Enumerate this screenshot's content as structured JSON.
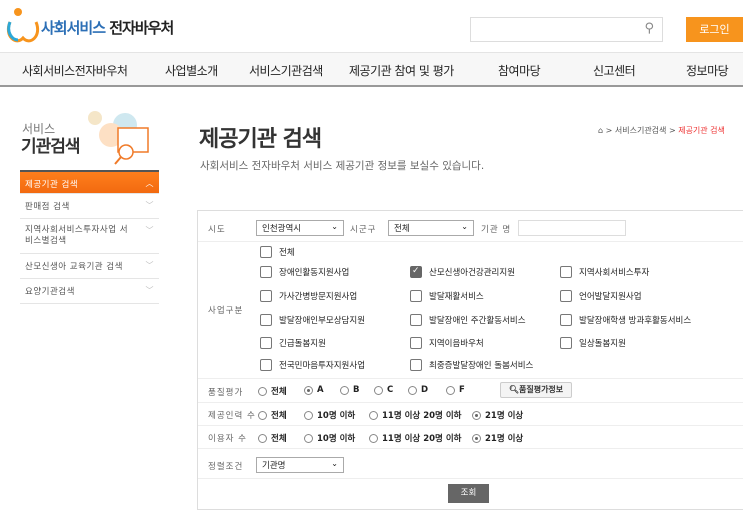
{
  "header": {
    "logo_part1": "사회서비스",
    "logo_part2": "전자바우처",
    "search_placeholder": "",
    "login": "로그인"
  },
  "nav": [
    "사회서비스전자바우처",
    "사업별소개",
    "서비스기관검색",
    "제공기관 참여 및 평가",
    "참여마당",
    "신고센터",
    "정보마당"
  ],
  "sidebar": {
    "title_small": "서비스",
    "title_large": "기관검색",
    "items": [
      {
        "label": "제공기관 검색",
        "active": true
      },
      {
        "label": "판매점 검색"
      },
      {
        "label": "지역사회서비스투자사업 서비스별검색"
      },
      {
        "label": "산모신생아 교육기관 검색"
      },
      {
        "label": "요양기관검색"
      }
    ]
  },
  "page": {
    "title": "제공기관 검색",
    "subtitle": "사회서비스 전자바우처 서비스 제공기관 정보를 보실수 있습니다.",
    "breadcrumb": [
      "서비스기관검색",
      "제공기관 검색"
    ]
  },
  "form": {
    "sido_label": "시도",
    "sido_value": "인천광역시",
    "sigungu_label": "시군구",
    "sigungu_value": "전체",
    "org_label": "기관 명",
    "org_value": "",
    "biz_label": "사업구분",
    "biz_items": [
      {
        "label": "전체",
        "checked": false
      },
      {
        "label": "장애인활동지원사업",
        "checked": false
      },
      {
        "label": "산모신생아건강관리지원",
        "checked": true
      },
      {
        "label": "지역사회서비스투자",
        "checked": false
      },
      {
        "label": "가사간병방문지원사업",
        "checked": false
      },
      {
        "label": "발달재활서비스",
        "checked": false
      },
      {
        "label": "언어발달지원사업",
        "checked": false
      },
      {
        "label": "발달장애인부모상담지원",
        "checked": false
      },
      {
        "label": "발달장애인 주간활동서비스",
        "checked": false
      },
      {
        "label": "발달장애학생 방과후활동서비스",
        "checked": false
      },
      {
        "label": "긴급돌봄지원",
        "checked": false
      },
      {
        "label": "지역이음바우처",
        "checked": false
      },
      {
        "label": "일상돌봄지원",
        "checked": false
      },
      {
        "label": "전국민마음투자지원사업",
        "checked": false
      },
      {
        "label": "최중증발달장애인 돌봄서비스",
        "checked": false
      }
    ],
    "quality_label": "품질평가",
    "quality_options": [
      "전체",
      "A",
      "B",
      "C",
      "D",
      "F"
    ],
    "quality_selected": "A",
    "quality_button": "품질평가정보",
    "staff_label": "제공인력 수",
    "staff_options": [
      "전체",
      "10명 이하",
      "11명 이상 20명 이하",
      "21명 이상"
    ],
    "staff_selected": "21명 이상",
    "users_label": "이용자 수",
    "users_options": [
      "전체",
      "10명 이하",
      "11명 이상 20명 이하",
      "21명 이상"
    ],
    "users_selected": "21명 이상",
    "sort_label": "정렬조건",
    "sort_value": "기관명",
    "submit": "조회"
  },
  "colors": {
    "accent": "#f7941d",
    "logo_blue": "#2c6fb6",
    "breadcrumb_current": "#e33333"
  }
}
